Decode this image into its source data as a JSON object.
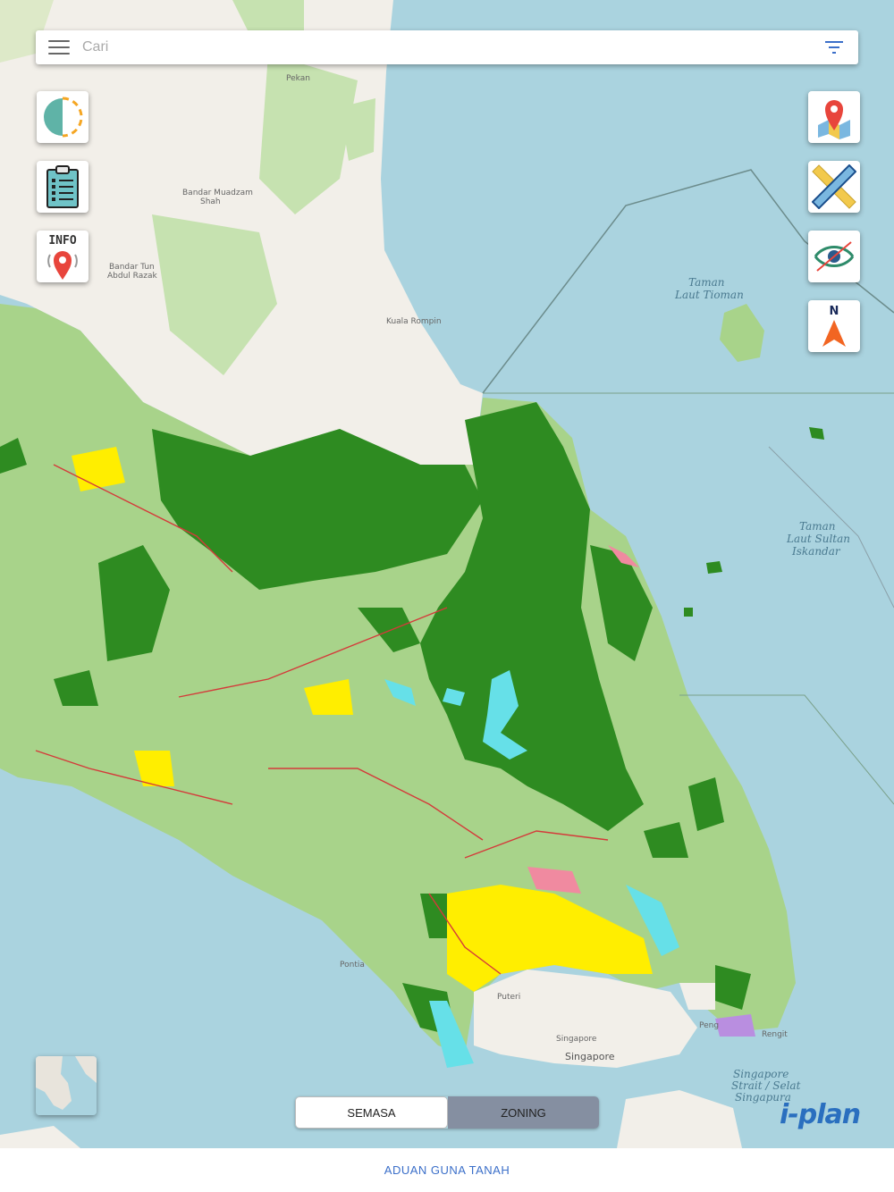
{
  "search": {
    "placeholder": "Cari"
  },
  "map_labels": {
    "pekan": "Pekan",
    "bandar_muadzam_shah_1": "Bandar Muadzam",
    "bandar_muadzam_shah_2": "Shah",
    "bandar_tun_abdul_razak_1": "Bandar Tun",
    "bandar_tun_abdul_razak_2": "Abdul Razak",
    "kuala_rompin": "Kuala Rompin",
    "taman_laut_tioman_1": "Taman",
    "taman_laut_tioman_2": "Laut Tioman",
    "taman_laut_sultan_1": "Taman",
    "taman_laut_sultan_2": "Laut Sultan",
    "taman_laut_sultan_3": "Iskandar",
    "singapore": "Singapore",
    "singapore_small": "Singapore",
    "singapore_strait_1": "Singapore",
    "singapore_strait_2": "Strait / Selat",
    "singapore_strait_3": "Singapura",
    "puteri": "Puteri",
    "pontian": "Pontia",
    "rengit": "Rengit",
    "pengerang": "Peng"
  },
  "tools": {
    "info_label": "INFO",
    "north_label": "N"
  },
  "segment": {
    "semasa": "SEMASA",
    "zoning": "ZONING",
    "active": "SEMASA"
  },
  "logo": {
    "text": "i-plan"
  },
  "footer": {
    "aduan": "ADUAN GUNA TANAH"
  },
  "colors": {
    "sea": "#aad3df",
    "land": "#f2efe9",
    "dark_green": "#2e8b21",
    "light_green": "#a8d38a",
    "yellow": "#ffee00",
    "accent_blue": "#3b6fc9"
  }
}
